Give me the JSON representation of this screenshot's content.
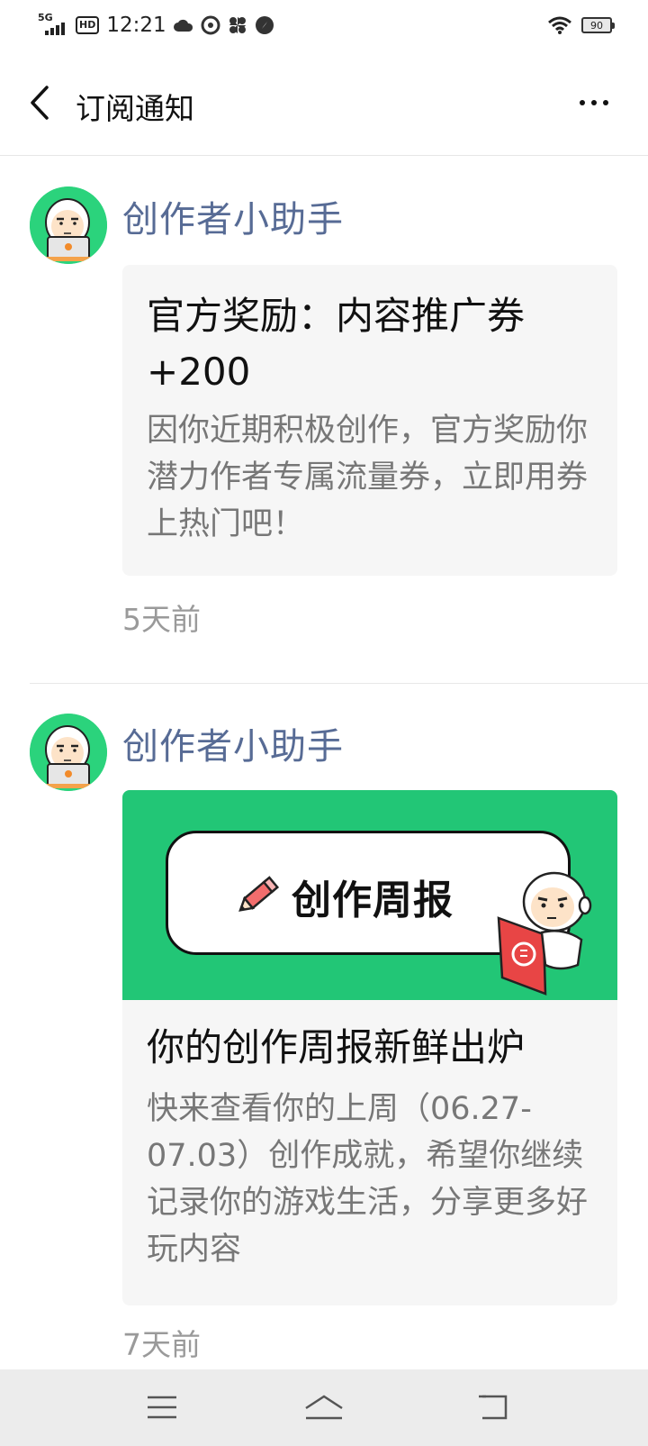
{
  "status_bar": {
    "network": "5G",
    "hd": "HD",
    "time": "12:21",
    "battery": "90"
  },
  "header": {
    "title": "订阅通知"
  },
  "messages": [
    {
      "sender": "创作者小助手",
      "card_title": "官方奖励：内容推广券+200",
      "card_desc": "因你近期积极创作，官方奖励你潜力作者专属流量券，立即用券上热门吧！",
      "time": "5天前"
    },
    {
      "sender": "创作者小助手",
      "banner_text": "创作周报",
      "card_title": "你的创作周报新鲜出炉",
      "card_desc": "快来查看你的上周（06.27-07.03）创作成就，希望你继续记录你的游戏生活，分享更多好玩内容",
      "time": "7天前"
    }
  ],
  "colors": {
    "sender_name": "#576b95",
    "avatar_bg": "#2bd37c",
    "banner_bg": "#22c676",
    "card_bg": "#f6f6f6"
  },
  "icons": {
    "back": "chevron-left-icon",
    "more": "more-dots-icon",
    "menu": "menu-icon",
    "home": "home-icon",
    "return": "back-arrow-icon"
  }
}
